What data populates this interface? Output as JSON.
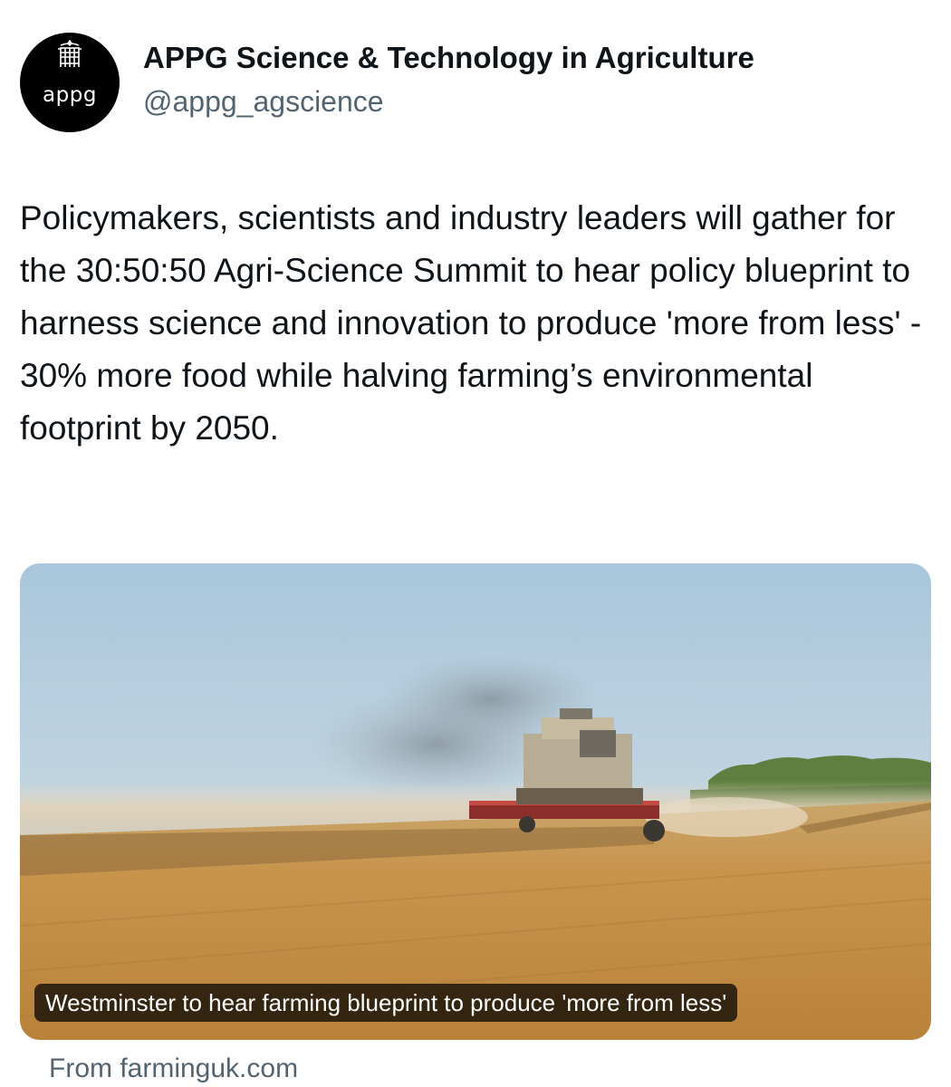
{
  "tweet": {
    "author": {
      "display_name": "APPG Science & Technology in Agriculture",
      "handle": "@appg_agscience",
      "avatar_text": "appg",
      "avatar_icon": "portcullis-icon"
    },
    "text": "Policymakers, scientists and industry leaders will gather for the 30:50:50 Agri-Science Summit to hear policy blueprint to harness science and innovation to produce 'more from less' - 30% more food while halving farming’s environmental footprint by 2050."
  },
  "link_card": {
    "image": "combine-harvester-in-wheat-field",
    "caption": "Westminster to hear farming blueprint to produce 'more from less'",
    "source": "From farminguk.com"
  },
  "colors": {
    "text_primary": "#0f1419",
    "text_secondary": "#536471",
    "avatar_bg": "#000000"
  }
}
